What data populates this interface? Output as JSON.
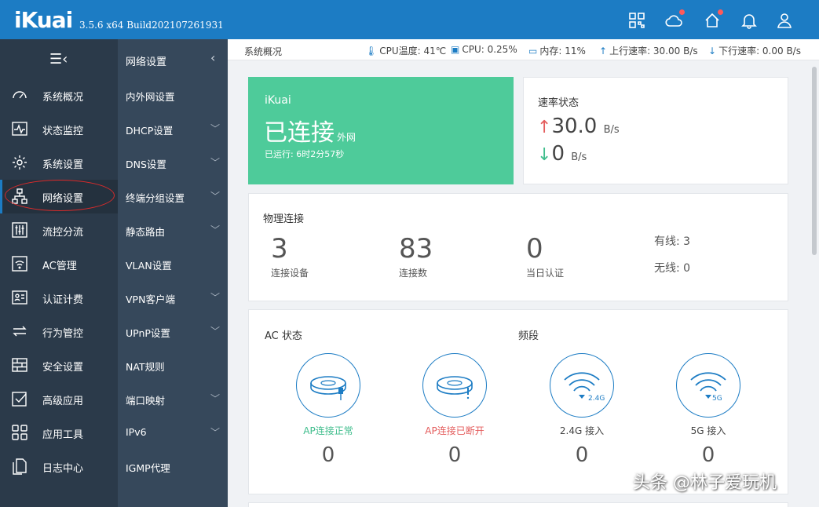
{
  "header": {
    "logo": "iKuai",
    "version": "3.5.6 x64 Build202107261931"
  },
  "icons": {
    "header": [
      "app-grid-icon",
      "cloud-icon",
      "home-icon",
      "bell-icon",
      "user-icon"
    ]
  },
  "sidebar": {
    "items": [
      {
        "label": "系统概况",
        "icon": "dashboard-icon"
      },
      {
        "label": "状态监控",
        "icon": "monitor-icon"
      },
      {
        "label": "系统设置",
        "icon": "gear-icon"
      },
      {
        "label": "网络设置",
        "icon": "network-icon"
      },
      {
        "label": "流控分流",
        "icon": "sliders-icon"
      },
      {
        "label": "AC管理",
        "icon": "wifi-icon"
      },
      {
        "label": "认证计费",
        "icon": "id-card-icon"
      },
      {
        "label": "行为管控",
        "icon": "arrows-icon"
      },
      {
        "label": "安全设置",
        "icon": "firewall-icon"
      },
      {
        "label": "高级应用",
        "icon": "check-box-icon"
      },
      {
        "label": "应用工具",
        "icon": "tools-grid-icon"
      },
      {
        "label": "日志中心",
        "icon": "documents-icon"
      }
    ]
  },
  "submenu": {
    "title": "网络设置",
    "items": [
      {
        "label": "内外网设置"
      },
      {
        "label": "DHCP设置"
      },
      {
        "label": "DNS设置"
      },
      {
        "label": "终端分组设置"
      },
      {
        "label": "静态路由"
      },
      {
        "label": "VLAN设置"
      },
      {
        "label": "VPN客户端"
      },
      {
        "label": "UPnP设置"
      },
      {
        "label": "NAT规则"
      },
      {
        "label": "端口映射"
      },
      {
        "label": "IPv6"
      },
      {
        "label": "IGMP代理"
      }
    ]
  },
  "statusbar": {
    "title": "系统概况",
    "cpu_temp": "CPU温度: 41℃",
    "cpu": "CPU: 0.25%",
    "mem": "内存: 11%",
    "up": "上行速率: 30.00 B/s",
    "down": "下行速率: 0.00 B/s"
  },
  "connection": {
    "brand": "iKuai",
    "status": "已连接",
    "type": "外网",
    "uptime": "已运行: 6时2分57秒"
  },
  "rate": {
    "title": "速率状态",
    "up_value": "30.0",
    "up_unit": "B/s",
    "down_value": "0",
    "down_unit": "B/s"
  },
  "physical": {
    "title": "物理连接",
    "devices_value": "3",
    "devices_label": "连接设备",
    "connections_value": "83",
    "connections_label": "连接数",
    "auth_value": "0",
    "auth_label": "当日认证",
    "wired": "有线: 3",
    "wireless": "无线: 0"
  },
  "ac": {
    "title": "AC 状态",
    "band_title": "频段",
    "items": [
      {
        "label": "AP连接正常",
        "value": "0",
        "color": "#3fbd8c"
      },
      {
        "label": "AP连接已断开",
        "value": "0",
        "color": "#e45d5d"
      },
      {
        "label": "2.4G 接入",
        "value": "0",
        "badge": "2.4G",
        "color": "#444444"
      },
      {
        "label": "5G 接入",
        "value": "0",
        "badge": "5G",
        "color": "#444444"
      }
    ]
  },
  "watermark": "头条 @林子爱玩机",
  "colors": {
    "header": "#1c7cc4",
    "sidebar": "#2b3a4a",
    "submenu": "#36485b",
    "connected": "#4ecb9a"
  }
}
